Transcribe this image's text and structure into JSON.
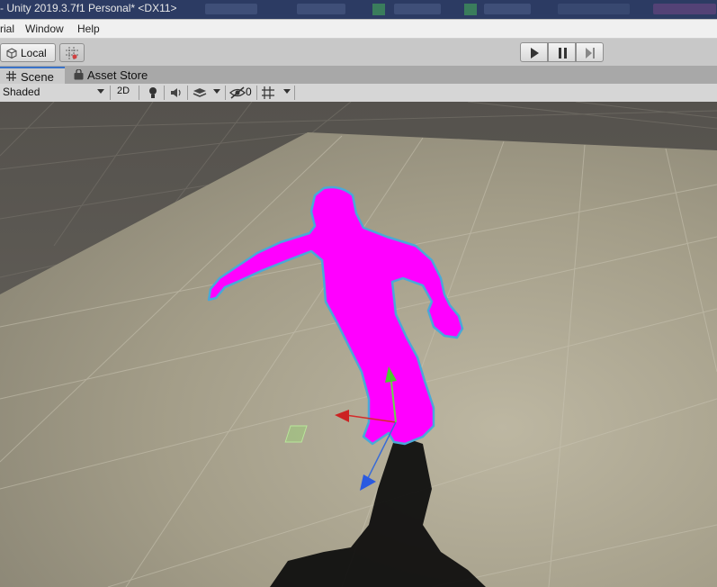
{
  "window": {
    "title": "- Unity 2019.3.7f1 Personal* <DX11>"
  },
  "menubar": {
    "items": [
      {
        "label": "rial"
      },
      {
        "label": "Window"
      },
      {
        "label": "Help"
      }
    ]
  },
  "toolbar": {
    "pivot_rotation_label": "Local",
    "play_icon": "play-icon",
    "pause_icon": "pause-icon",
    "step_icon": "step-icon"
  },
  "tabs": [
    {
      "label": "Scene",
      "icon": "grid-icon",
      "active": true
    },
    {
      "label": "Asset Store",
      "icon": "bag-icon",
      "active": false
    }
  ],
  "scene_toolbar": {
    "draw_mode": "Shaded",
    "mode_2d_label": "2D",
    "hidden_objects_count": "0"
  },
  "colors": {
    "titlebar": "#2c3b63",
    "accent_tab": "#3a72c8",
    "character": "#ff00ff",
    "ground": "#a09a86",
    "outline": "#4aa8d8"
  }
}
